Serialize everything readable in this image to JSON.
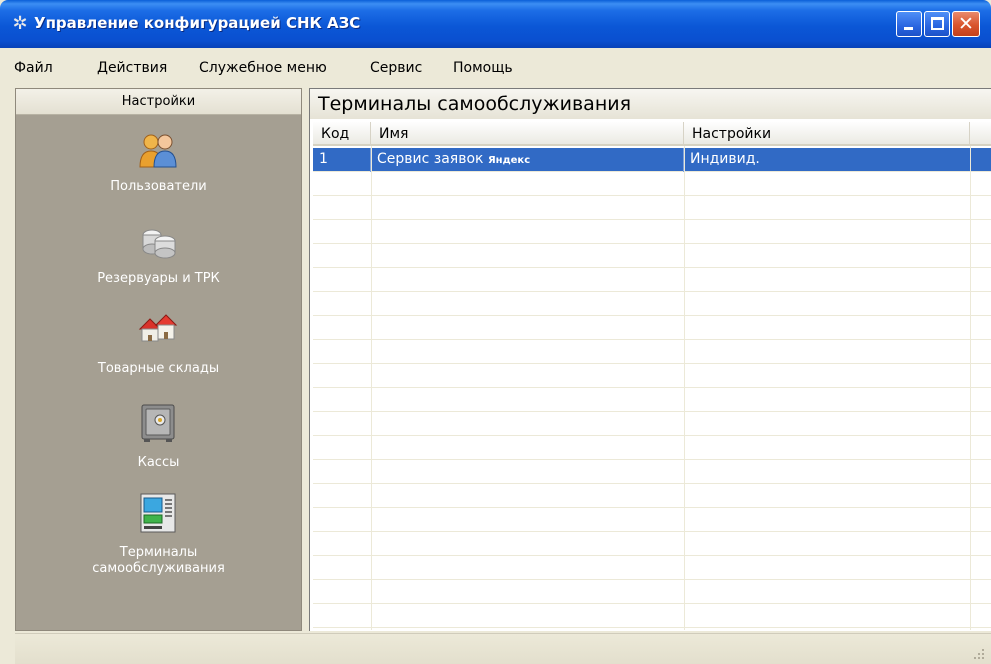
{
  "window": {
    "title": "Управление конфигурацией СНК АЗС",
    "icon": "gear-icon",
    "controls": {
      "minimize": "minimize-icon",
      "maximize": "maximize-icon",
      "close": "close-icon",
      "close_glyph": "✕"
    }
  },
  "menu": [
    {
      "label": "Файл"
    },
    {
      "label": "Действия"
    },
    {
      "label": "Служебное меню"
    },
    {
      "label": "Сервис"
    },
    {
      "label": "Помощь"
    }
  ],
  "sidebar": {
    "header": "Настройки",
    "items": [
      {
        "label": "Пользователи",
        "icon": "users-icon"
      },
      {
        "label": "Резервуары и ТРК",
        "icon": "tanks-icon"
      },
      {
        "label": "Товарные склады",
        "icon": "warehouse-icon"
      },
      {
        "label": "Кассы",
        "icon": "safe-icon"
      },
      {
        "label": "Терминалы",
        "label2": "самообслуживания",
        "icon": "terminal-icon"
      }
    ]
  },
  "main": {
    "title": "Терминалы самообслуживания",
    "table": {
      "columns": [
        "Код",
        "Имя",
        "Настройки"
      ],
      "rows": [
        {
          "code": "1",
          "name": "Сервис заявок",
          "name_brand": "Яндекс",
          "settings": "Индивид.",
          "selected": true
        }
      ]
    }
  },
  "colors": {
    "titlebar": "#0b57d6",
    "sidebar": "#a59f92",
    "selection": "#316ac5"
  }
}
